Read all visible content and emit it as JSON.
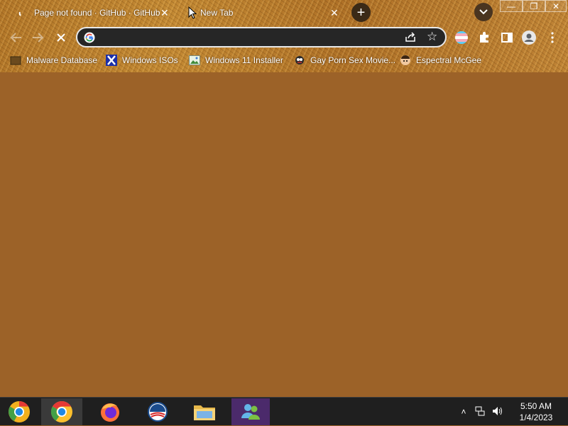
{
  "browser": {
    "tabs": [
      {
        "title": "Page not found · GitHub · GitHub",
        "close": "✕",
        "active": false
      },
      {
        "title": "New Tab",
        "close": "✕",
        "active": true
      }
    ],
    "new_tab_symbol": "+",
    "window_controls": {
      "minimize": "—",
      "maximize": "❐",
      "close": "✕"
    },
    "toolbar": {
      "back_icon": "arrow-left-icon",
      "forward_icon": "arrow-right-icon",
      "stop_icon": "stop-icon",
      "address_value": "",
      "address_placeholder": ""
    },
    "bookmarks": [
      {
        "label": "Malware Database",
        "icon": "malware-favicon"
      },
      {
        "label": "Windows ISOs",
        "icon": "x-favicon"
      },
      {
        "label": "Windows 11 Installer",
        "icon": "image-favicon"
      },
      {
        "label": "Gay Porn Sex Movie...",
        "icon": "sonic-favicon"
      },
      {
        "label": "Espectral McGee",
        "icon": "avatar-favicon"
      }
    ]
  },
  "taskbar": {
    "pinned": [
      {
        "name": "Chrome Canary",
        "icon": "chrome-canary-icon"
      },
      {
        "name": "Google Chrome",
        "icon": "chrome-icon",
        "active": true
      },
      {
        "name": "Firefox",
        "icon": "firefox-icon"
      },
      {
        "name": "Obama logo",
        "icon": "obama-logo-icon"
      },
      {
        "name": "File Explorer",
        "icon": "folder-icon"
      },
      {
        "name": "Windows Live Messenger",
        "icon": "messenger-icon"
      }
    ],
    "tray": {
      "chevron": "˄",
      "time": "5:50 AM",
      "date": "1/4/2023"
    }
  },
  "colors": {
    "page_background": "#9c6228",
    "theme_texture": "#b4782a",
    "taskbar": "#1f1f1f",
    "omnibox": "#262626"
  }
}
